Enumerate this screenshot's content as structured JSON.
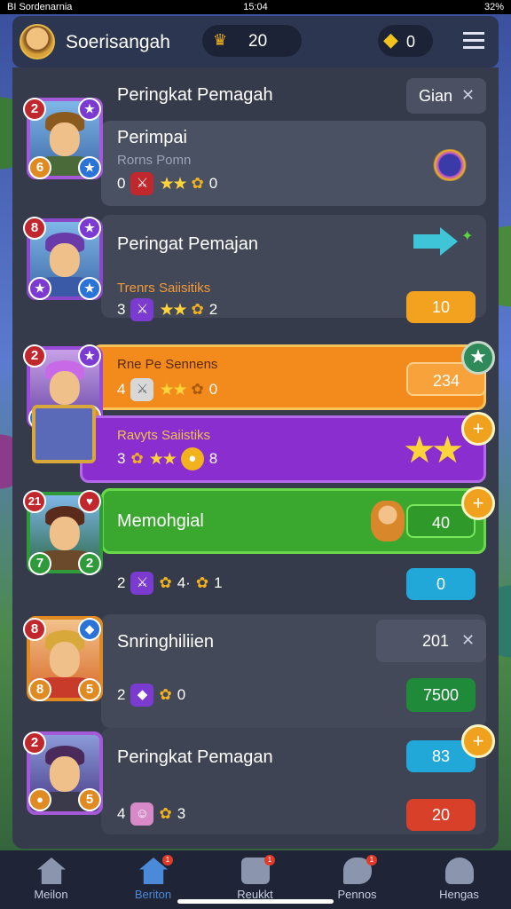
{
  "status_bar": {
    "left": "BI Sordenarnia",
    "time": "15:04",
    "right": "32%"
  },
  "header": {
    "title": "Soerisangah",
    "crown_count": "20",
    "gem_count": "0"
  },
  "search": {
    "title": "Peringkat Pemagah",
    "filter_label": "Gian",
    "close": "✕"
  },
  "entries": [
    {
      "rank": "2",
      "corner_badge": "★",
      "level": "6",
      "title": "Perimpai",
      "subtitle": "Rorns Pomn",
      "count_a": "0",
      "stars": "★★",
      "count_b": "0"
    },
    {
      "rank": "8",
      "corner_badge": "★",
      "level": "★",
      "title": "Peringat Pemajan",
      "subtitle": "Trenrs Saiisitiks",
      "count_a": "3",
      "stars": "★★",
      "count_b": "2",
      "button": "10"
    },
    {
      "rank": "2",
      "corner_badge": "★",
      "level": "★",
      "subtitle": "Rne Pe Sennens",
      "count_a": "4",
      "stars": "★★",
      "count_b": "0",
      "button": "234"
    },
    {
      "subtitle": "Ravyts Saiistiks",
      "count_a": "3",
      "stars": "★★",
      "count_b": "8"
    },
    {
      "rank": "21",
      "corner_badge": "♥",
      "level": "7",
      "level_b": "2",
      "title": "Memohgial",
      "button": "40",
      "count_a": "2",
      "stars": "4·",
      "count_b": "1",
      "button2": "0"
    },
    {
      "rank": "8",
      "level": "8",
      "level_b": "5",
      "title": "Snringhiliien",
      "box_value": "201",
      "close": "✕",
      "count_a": "2",
      "count_b": "0",
      "button": "7500"
    },
    {
      "rank": "2",
      "level": "5",
      "title": "Peringkat Pemagan",
      "button": "83",
      "count_a": "4",
      "count_b": "3",
      "button2": "20"
    }
  ],
  "nav": [
    {
      "label": "Meilon",
      "icon": "home-icon"
    },
    {
      "label": "Beriton",
      "icon": "house-alert-icon",
      "badge": "1"
    },
    {
      "label": "Reukkt",
      "icon": "flag-icon",
      "badge": "1"
    },
    {
      "label": "Pennos",
      "icon": "chat-icon",
      "badge": "1"
    },
    {
      "label": "Hengas",
      "icon": "person-icon"
    }
  ],
  "colors": {
    "panel": "#353b4a",
    "orange": "#f28a1c",
    "purple": "#8a2ed0",
    "green": "#3aa82e"
  }
}
